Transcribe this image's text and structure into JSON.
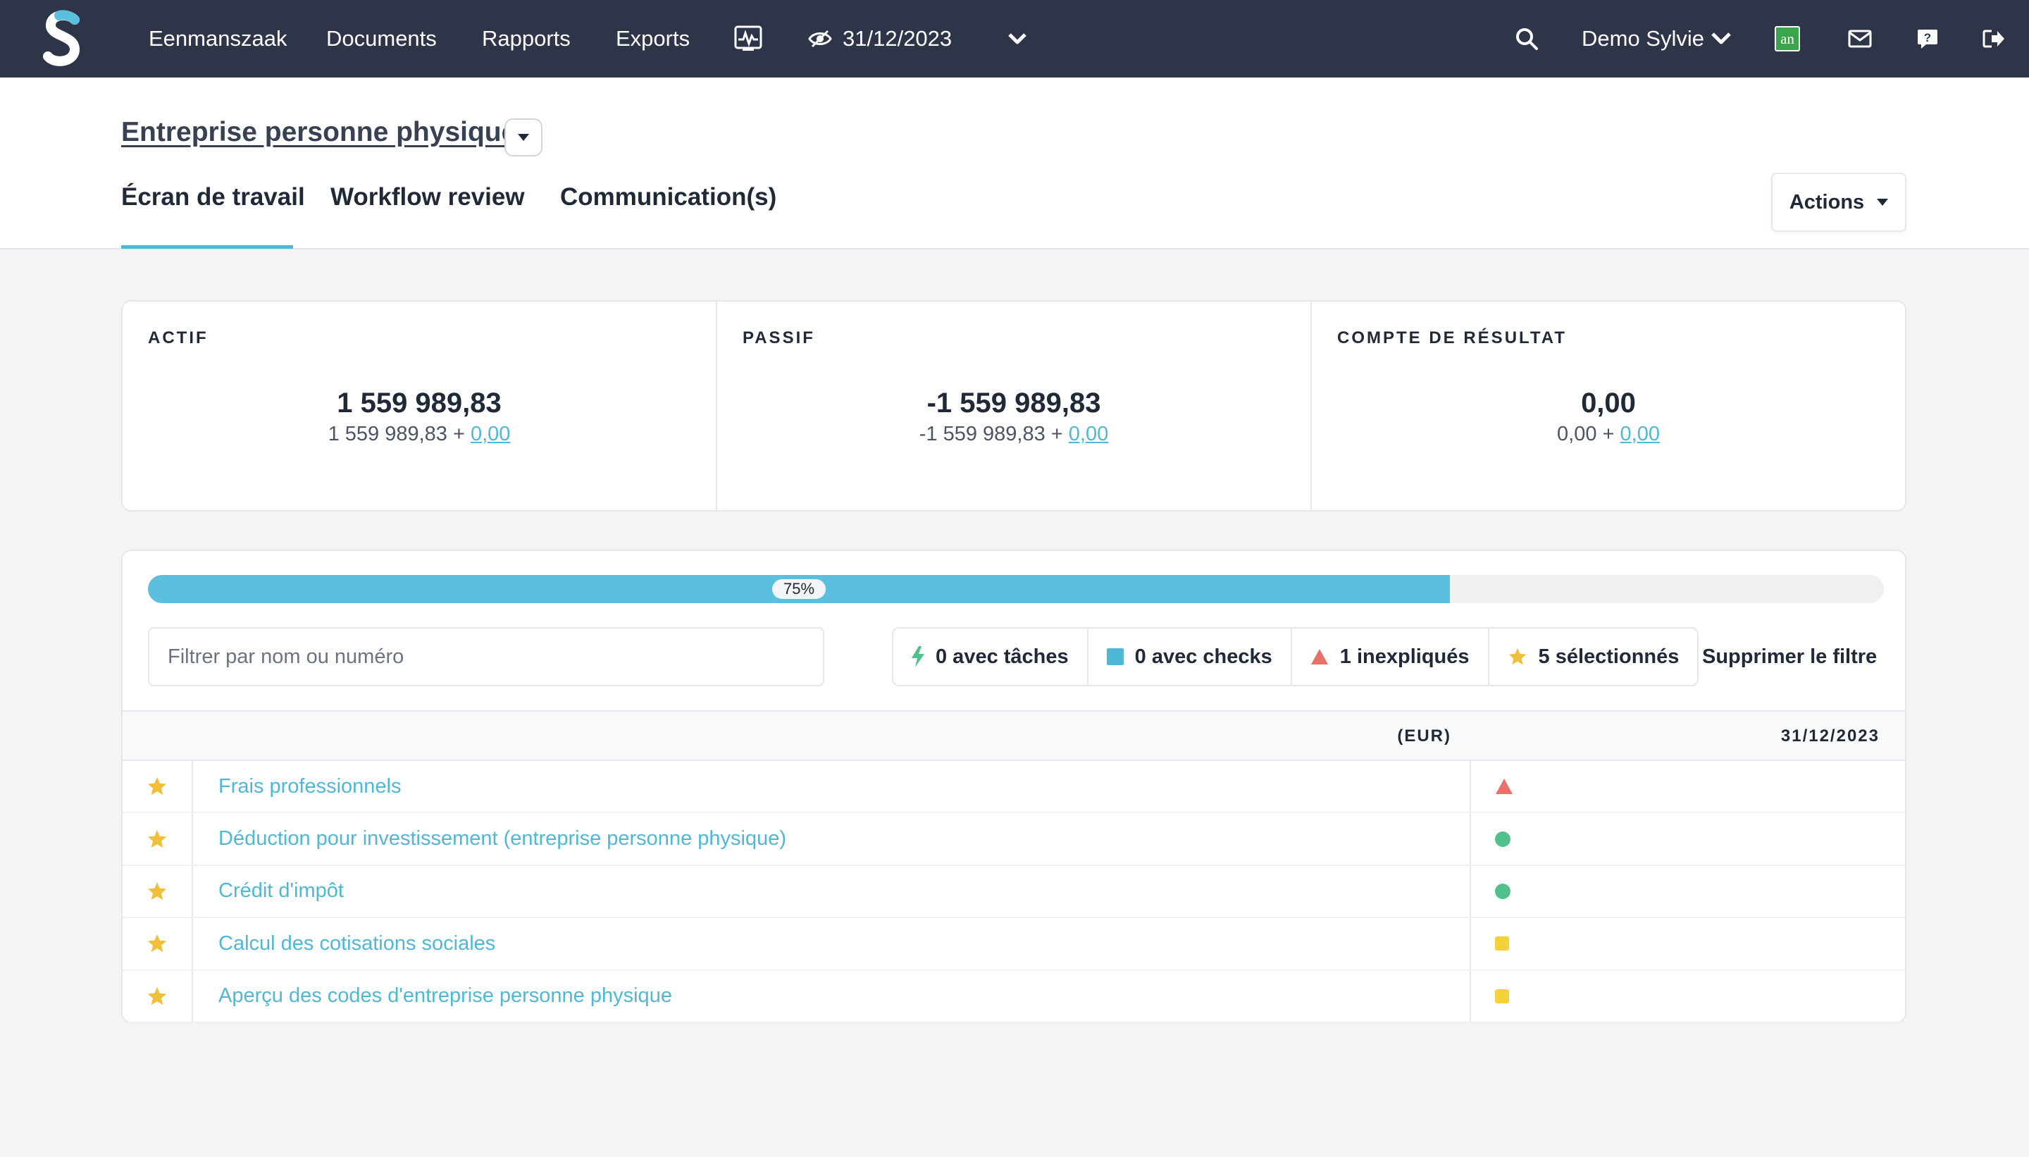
{
  "nav": {
    "logo_icon": "s-logo-icon",
    "items": [
      "Eenmanszaak",
      "Documents",
      "Rapports",
      "Exports"
    ],
    "activity_icon": "activity-monitor-icon",
    "visibility_icon": "eye-slash-icon",
    "date": "31/12/2023",
    "date_dropdown_icon": "chevron-down-icon",
    "search_icon": "search-icon",
    "user_name": "Demo Sylvie",
    "user_dropdown_icon": "chevron-down-icon",
    "badge_text": "an",
    "mail_icon": "mail-icon",
    "help_icon": "help-icon",
    "logout_icon": "logout-icon"
  },
  "header": {
    "entity_title": "Entreprise personne physique",
    "tabs": [
      "Écran de travail",
      "Workflow review",
      "Communication(s)"
    ],
    "active_tab": "Écran de travail",
    "actions_label": "Actions"
  },
  "summary": {
    "actif": {
      "label": "ACTIF",
      "main": "1 559 989,83",
      "sub_base": "1 559 989,83 + ",
      "sub_link": "0,00"
    },
    "passif": {
      "label": "PASSIF",
      "main": "-1 559 989,83",
      "sub_base": "-1 559 989,83 + ",
      "sub_link": "0,00"
    },
    "resultat": {
      "label": "COMPTE DE RÉSULTAT",
      "main": "0,00",
      "sub_base": "0,00 + ",
      "sub_link": "0,00"
    }
  },
  "progress": {
    "value": 0.75,
    "label": "75%"
  },
  "filter": {
    "placeholder": "Filtrer par nom ou numéro",
    "value": "",
    "chips": [
      {
        "icon": "bolt-icon",
        "label": "0 avec tâches"
      },
      {
        "icon": "square-icon",
        "label": "0 avec checks"
      },
      {
        "icon": "triangle-warning-icon",
        "label": "1 inexpliqués"
      },
      {
        "icon": "star-icon",
        "label": "5 sélectionnés"
      }
    ],
    "clear_label": "Supprimer le filtre"
  },
  "table": {
    "col_currency": "(EUR)",
    "col_date": "31/12/2023",
    "rows": [
      {
        "name": "Frais professionnels",
        "status": "triangle"
      },
      {
        "name": "Déduction pour investissement (entreprise personne physique)",
        "status": "green-dot"
      },
      {
        "name": "Crédit d'impôt",
        "status": "green-dot"
      },
      {
        "name": "Calcul des cotisations sociales",
        "status": "yellow-square"
      },
      {
        "name": "Aperçu des codes d'entreprise personne physique",
        "status": "yellow-square"
      }
    ]
  },
  "colors": {
    "nav_bg": "#2e3548",
    "accent": "#4fb8d6",
    "progress": "#5bc0de",
    "star": "#f0c03a",
    "red": "#e8716a",
    "green": "#52c08a",
    "yellow": "#f5d13b",
    "badge_green": "#3aa54a"
  }
}
